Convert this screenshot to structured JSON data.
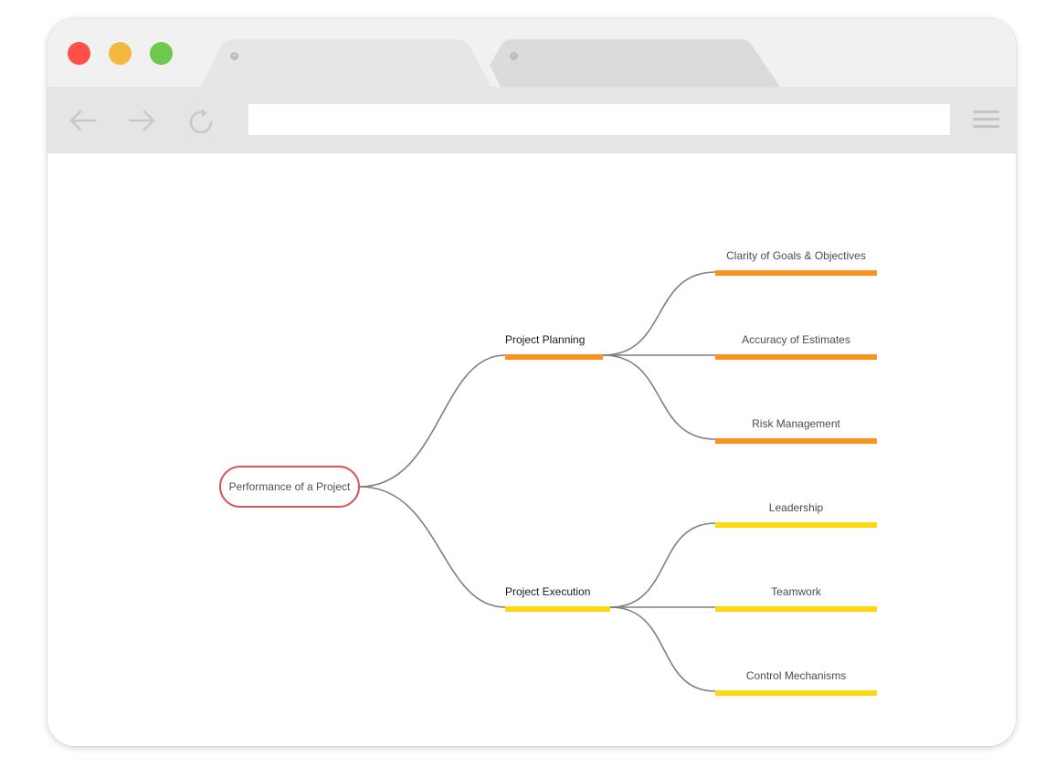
{
  "browser": {
    "tabs": [
      {
        "label": "",
        "active": true
      },
      {
        "label": "",
        "active": false
      }
    ],
    "address_bar": {
      "value": "",
      "placeholder": ""
    },
    "icons": {
      "back": "arrow-left-icon",
      "forward": "arrow-right-icon",
      "reload": "reload-icon",
      "menu": "hamburger-menu-icon",
      "tab_close": "close-icon"
    }
  },
  "mindmap": {
    "root": {
      "label": "Performance of a Project",
      "border_color": "#d6545a"
    },
    "branches": [
      {
        "label": "Project Planning",
        "color": "#f7931e",
        "children": [
          {
            "label": "Clarity of Goals &  Objectives"
          },
          {
            "label": "Accuracy of Estimates"
          },
          {
            "label": "Risk Management"
          }
        ]
      },
      {
        "label": "Project Execution",
        "color": "#fbd80f",
        "children": [
          {
            "label": "Leadership"
          },
          {
            "label": "Teamwork"
          },
          {
            "label": "Control Mechanisms"
          }
        ]
      }
    ],
    "connector_color": "#7f7f7f"
  },
  "colors": {
    "traffic_red": "#fe5046",
    "traffic_yellow": "#f3b93f",
    "traffic_green": "#6cc949"
  }
}
